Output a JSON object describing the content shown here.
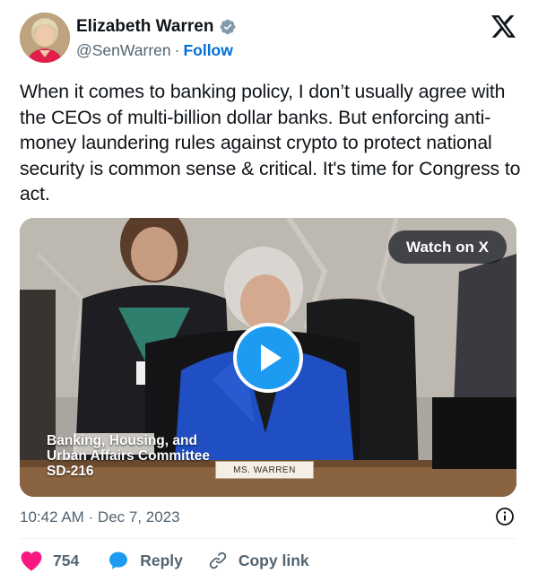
{
  "author": {
    "name": "Elizabeth Warren",
    "handle": "@SenWarren",
    "separator": "·",
    "follow_label": "Follow",
    "verified": true
  },
  "icons": {
    "avatar": "profile-photo",
    "verified": "verified-badge-icon",
    "brand": "x-logo-icon",
    "play": "play-icon",
    "info": "info-icon",
    "like": "heart-icon",
    "reply": "speech-bubble-icon",
    "copy": "link-icon"
  },
  "tweet": {
    "text": "When it comes to banking policy, I don’t usually agree with the CEOs of multi-billion dollar banks. But enforcing anti-money laundering rules against crypto to protect national security is common sense & critical. It's time for Congress to act."
  },
  "media": {
    "watch_label": "Watch on X",
    "caption_line1": "Banking, Housing, and",
    "caption_line2": "Urban Affairs Committee",
    "caption_line3": "SD-216",
    "nameplate": "MS. WARREN"
  },
  "meta": {
    "timestamp": "10:42 AM · Dec 7, 2023"
  },
  "actions": {
    "like_count": "754",
    "reply_label": "Reply",
    "copy_label": "Copy link"
  },
  "colors": {
    "accent": "#1d9bf0",
    "like": "#f91880",
    "follow": "#006fd6",
    "muted": "#536471",
    "text": "#0f1419"
  }
}
